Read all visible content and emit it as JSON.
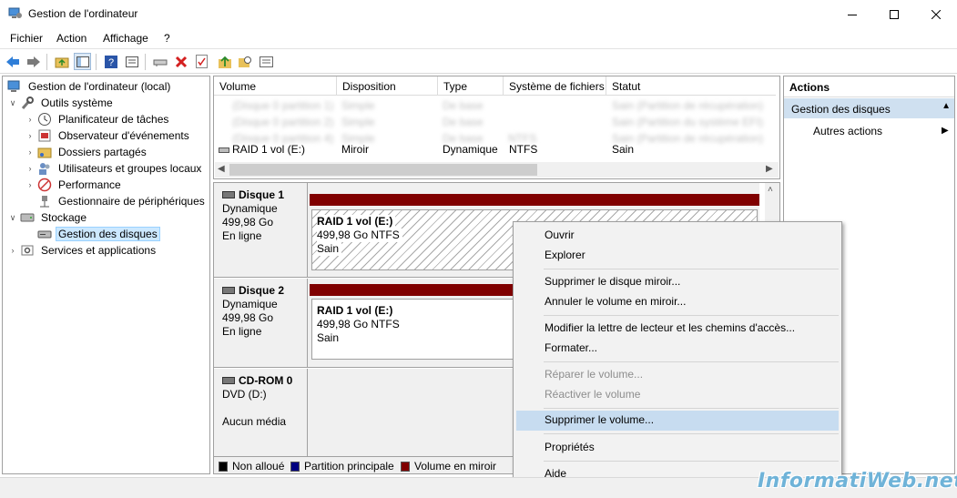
{
  "window": {
    "title": "Gestion de l'ordinateur"
  },
  "menu": [
    "Fichier",
    "Action",
    "Affichage",
    "?"
  ],
  "tree": {
    "items": [
      {
        "label": "Gestion de l'ordinateur (local)"
      },
      {
        "label": "Outils système"
      },
      {
        "label": "Planificateur de tâches"
      },
      {
        "label": "Observateur d'événements"
      },
      {
        "label": "Dossiers partagés"
      },
      {
        "label": "Utilisateurs et groupes locaux"
      },
      {
        "label": "Performance"
      },
      {
        "label": "Gestionnaire de périphériques"
      },
      {
        "label": "Stockage"
      },
      {
        "label": "Gestion des disques"
      },
      {
        "label": "Services et applications"
      }
    ]
  },
  "volumes": {
    "columns": [
      "Volume",
      "Disposition",
      "Type",
      "Système de fichiers",
      "Statut"
    ],
    "blurred_rows": [
      [
        "(Disque 0 partition 1)",
        "Simple",
        "De base",
        "",
        "Sain (Partition de récupération)"
      ],
      [
        "(Disque 0 partition 2)",
        "Simple",
        "De base",
        "",
        "Sain (Partition du système EFI)"
      ],
      [
        "(Disque 0 partition 4)",
        "Simple",
        "De base",
        "NTFS",
        "Sain (Partition de récupération)"
      ]
    ],
    "rows": [
      [
        "RAID 1 vol (E:)",
        "Miroir",
        "Dynamique",
        "NTFS",
        "Sain"
      ]
    ]
  },
  "disks": [
    {
      "name": "Disque 1",
      "type": "Dynamique",
      "size": "499,98 Go",
      "status": "En ligne",
      "volume": {
        "name": "RAID 1 vol  (E:)",
        "size": "499,98 Go NTFS",
        "status": "Sain"
      }
    },
    {
      "name": "Disque 2",
      "type": "Dynamique",
      "size": "499,98 Go",
      "status": "En ligne",
      "volume": {
        "name": "RAID 1 vol  (E:)",
        "size": "499,98 Go NTFS",
        "status": "Sain"
      }
    },
    {
      "name": "CD-ROM 0",
      "type": "DVD (D:)",
      "size": "",
      "status": "Aucun média"
    }
  ],
  "legend": [
    {
      "label": "Non alloué",
      "color": "#000000"
    },
    {
      "label": "Partition principale",
      "color": "#000080"
    },
    {
      "label": "Volume en miroir",
      "color": "#800000"
    }
  ],
  "actions": {
    "header": "Actions",
    "section": "Gestion des disques",
    "more": "Autres actions"
  },
  "context_menu": {
    "items": [
      {
        "label": "Ouvrir",
        "state": "enabled"
      },
      {
        "label": "Explorer",
        "state": "enabled"
      },
      {
        "label": "Supprimer le disque miroir...",
        "state": "enabled"
      },
      {
        "label": "Annuler le volume en miroir...",
        "state": "enabled"
      },
      {
        "label": "Modifier la lettre de lecteur et les chemins d'accès...",
        "state": "enabled"
      },
      {
        "label": "Formater...",
        "state": "enabled"
      },
      {
        "label": "Réparer le volume...",
        "state": "disabled"
      },
      {
        "label": "Réactiver le volume",
        "state": "disabled"
      },
      {
        "label": "Supprimer le volume...",
        "state": "highlighted"
      },
      {
        "label": "Propriétés",
        "state": "enabled"
      },
      {
        "label": "Aide",
        "state": "enabled"
      }
    ]
  },
  "watermark": "InformatiWeb.net"
}
